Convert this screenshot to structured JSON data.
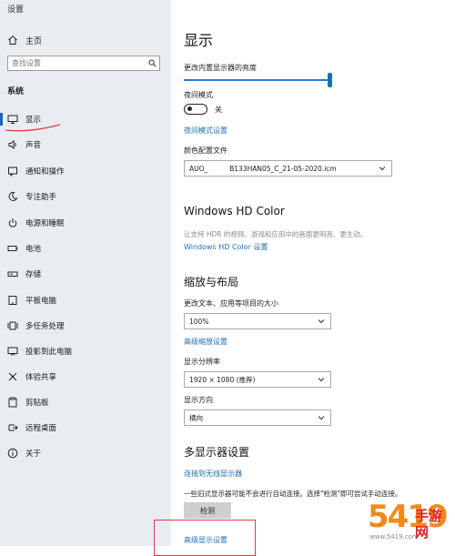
{
  "window": {
    "title": "设置"
  },
  "sidebar": {
    "home_label": "主页",
    "search_placeholder": "查找设置",
    "section_heading": "系统",
    "items": [
      {
        "label": "显示",
        "icon": "monitor-icon",
        "active": true
      },
      {
        "label": "声音",
        "icon": "speaker-icon"
      },
      {
        "label": "通知和操作",
        "icon": "notification-icon"
      },
      {
        "label": "专注助手",
        "icon": "moon-icon"
      },
      {
        "label": "电源和睡眠",
        "icon": "power-icon"
      },
      {
        "label": "电池",
        "icon": "battery-icon"
      },
      {
        "label": "存储",
        "icon": "storage-icon"
      },
      {
        "label": "平板电脑",
        "icon": "tablet-icon"
      },
      {
        "label": "多任务处理",
        "icon": "multitasking-icon"
      },
      {
        "label": "投影到此电脑",
        "icon": "project-icon"
      },
      {
        "label": "体验共享",
        "icon": "share-icon"
      },
      {
        "label": "剪贴板",
        "icon": "clipboard-icon"
      },
      {
        "label": "远程桌面",
        "icon": "remote-desktop-icon"
      },
      {
        "label": "关于",
        "icon": "info-icon"
      }
    ]
  },
  "main": {
    "title": "显示",
    "brightness_label": "更改内置显示器的亮度",
    "brightness_level": 1.0,
    "night_mode_label": "夜间模式",
    "night_mode_state": "关",
    "night_mode_settings_link": "夜间模式设置",
    "color_profile_label": "颜色配置文件",
    "color_profile_value": "AUO_          B133HAN05_C_21-05-2020.icm",
    "hd_color_heading": "Windows HD Color",
    "hd_color_desc": "让支持 HDR 的视频、游戏和应用中的画面更明亮、更生动。",
    "hd_color_link": "Windows HD Color 设置",
    "scale_heading": "缩放与布局",
    "scale_label": "更改文本、应用等项目的大小",
    "scale_value": "100%",
    "advanced_scaling_link": "高级缩放设置",
    "resolution_label": "显示分辨率",
    "resolution_value": "1920 × 1080 (推荐)",
    "orientation_label": "显示方向",
    "orientation_value": "横向",
    "multi_display_heading": "多显示器设置",
    "wireless_link": "连接到无线显示器",
    "detect_desc": "一些旧式显示器可能不会进行自动连接。选择\"检测\"即可尝试手动连接。",
    "detect_button": "检测",
    "advanced_display_link": "高级显示设置"
  },
  "watermark": {
    "number": "5419",
    "text": "手游网",
    "url": "www.5419.com"
  },
  "colors": {
    "accent": "#1565c0",
    "link": "#1f6fb2",
    "annotation": "#e23a4a",
    "sidebar_bg": "#e9edf1"
  }
}
